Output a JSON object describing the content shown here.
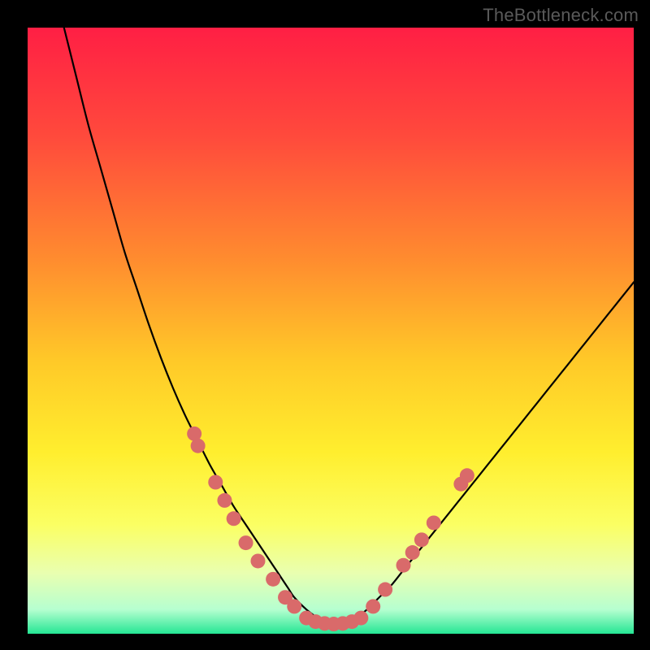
{
  "watermark": "TheBottleneck.com",
  "chart_data": {
    "type": "line",
    "title": "",
    "xlabel": "",
    "ylabel": "",
    "xlim": [
      0,
      100
    ],
    "ylim": [
      0,
      100
    ],
    "grid": false,
    "legend": false,
    "background_gradient": {
      "stops": [
        {
          "offset": 0.0,
          "color": "#ff1f44"
        },
        {
          "offset": 0.18,
          "color": "#ff4a3c"
        },
        {
          "offset": 0.38,
          "color": "#ff8b2f"
        },
        {
          "offset": 0.55,
          "color": "#ffc928"
        },
        {
          "offset": 0.7,
          "color": "#ffee2e"
        },
        {
          "offset": 0.82,
          "color": "#fbff63"
        },
        {
          "offset": 0.9,
          "color": "#e9ffb0"
        },
        {
          "offset": 0.96,
          "color": "#b6ffd0"
        },
        {
          "offset": 1.0,
          "color": "#25e694"
        }
      ]
    },
    "series": [
      {
        "name": "curve",
        "color": "#000000",
        "stroke_width": 2.2,
        "x": [
          6,
          8,
          10,
          12,
          14,
          16,
          18,
          20,
          22,
          24,
          26,
          28,
          30,
          32,
          34,
          36,
          38,
          40,
          41,
          42,
          43,
          44,
          46,
          48,
          50,
          52,
          54,
          56,
          57,
          58,
          60,
          62,
          64,
          66,
          68,
          70,
          72,
          74,
          76,
          78,
          80,
          82,
          84,
          86,
          88,
          90,
          92,
          94,
          96,
          98,
          100
        ],
        "y": [
          100,
          92,
          84,
          77,
          70,
          63,
          57,
          51,
          45.5,
          40.5,
          36,
          32,
          28,
          24.5,
          21,
          18,
          15,
          12,
          10.5,
          9,
          7.5,
          6,
          4,
          2.5,
          1.5,
          1.5,
          2.5,
          4,
          5,
          6,
          8,
          10.5,
          13,
          15.5,
          18,
          20.5,
          23,
          25.5,
          28,
          30.5,
          33,
          35.5,
          38,
          40.5,
          43,
          45.5,
          48,
          50.5,
          53,
          55.5,
          58
        ]
      }
    ],
    "scatter": {
      "name": "markers",
      "color": "#d96a6a",
      "radius": 9,
      "points": [
        {
          "x": 27.5,
          "y": 33
        },
        {
          "x": 28.1,
          "y": 31
        },
        {
          "x": 31.0,
          "y": 25
        },
        {
          "x": 32.5,
          "y": 22
        },
        {
          "x": 34.0,
          "y": 19
        },
        {
          "x": 36.0,
          "y": 15
        },
        {
          "x": 38.0,
          "y": 12
        },
        {
          "x": 40.5,
          "y": 9
        },
        {
          "x": 42.5,
          "y": 6
        },
        {
          "x": 44.0,
          "y": 4.5
        },
        {
          "x": 46.0,
          "y": 2.6
        },
        {
          "x": 47.5,
          "y": 2.0
        },
        {
          "x": 49.0,
          "y": 1.7
        },
        {
          "x": 50.5,
          "y": 1.6
        },
        {
          "x": 52.0,
          "y": 1.7
        },
        {
          "x": 53.5,
          "y": 2.0
        },
        {
          "x": 55.0,
          "y": 2.6
        },
        {
          "x": 57.0,
          "y": 4.5
        },
        {
          "x": 59.0,
          "y": 7.3
        },
        {
          "x": 62.0,
          "y": 11.3
        },
        {
          "x": 63.5,
          "y": 13.4
        },
        {
          "x": 65.0,
          "y": 15.5
        },
        {
          "x": 67.0,
          "y": 18.3
        },
        {
          "x": 71.5,
          "y": 24.7
        },
        {
          "x": 72.5,
          "y": 26.1
        }
      ]
    }
  }
}
